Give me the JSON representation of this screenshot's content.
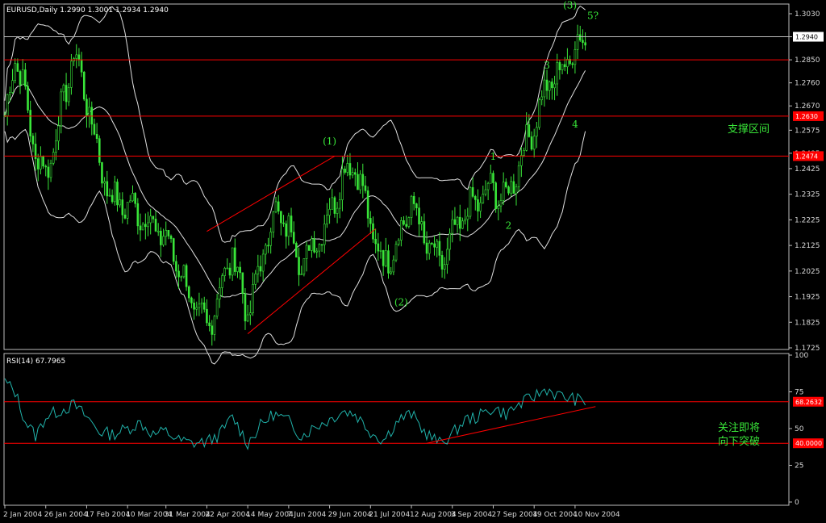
{
  "chart_data": [
    {
      "type": "candlestick",
      "title": "EURUSD,Daily  1.2990 1.3001 1.2934 1.2940",
      "ylim": [
        1.1725,
        1.304
      ],
      "y_ticks": [
        "1.3030",
        "1.2940",
        "1.2850",
        "1.2760",
        "1.2670",
        "1.2575",
        "1.2485",
        "1.2425",
        "1.2325",
        "1.2225",
        "1.2125",
        "1.2025",
        "1.1925",
        "1.1825",
        "1.1725"
      ],
      "x_ticks": [
        "2 Jan 2004",
        "26 Jan 2004",
        "17 Feb 2004",
        "10 Mar 2004",
        "31 Mar 2004",
        "22 Apr 2004",
        "14 May 2004",
        "7 Jun 2004",
        "29 Jun 2004",
        "21 Jul 2004",
        "12 Aug 2004",
        "3 Sep 2004",
        "27 Sep 2004",
        "19 Oct 2004",
        "10 Nov 2004"
      ],
      "current_price": "1.2940",
      "price_path": [
        [
          "2 Jan 2004",
          1.26
        ],
        [
          "8 Jan 2004",
          1.288
        ],
        [
          "14 Jan 2004",
          1.27
        ],
        [
          "20 Jan 2004",
          1.248
        ],
        [
          "26 Jan 2004",
          1.24
        ],
        [
          "2 Feb 2004",
          1.26
        ],
        [
          "10 Feb 2004",
          1.288
        ],
        [
          "17 Feb 2004",
          1.27
        ],
        [
          "24 Feb 2004",
          1.245
        ],
        [
          "2 Mar 2004",
          1.23
        ],
        [
          "10 Mar 2004",
          1.228
        ],
        [
          "17 Mar 2004",
          1.225
        ],
        [
          "24 Mar 2004",
          1.22
        ],
        [
          "31 Mar 2004",
          1.215
        ],
        [
          "7 Apr 2004",
          1.205
        ],
        [
          "14 Apr 2004",
          1.19
        ],
        [
          "22 Apr 2004",
          1.18
        ],
        [
          "29 Apr 2004",
          1.195
        ],
        [
          "6 May 2004",
          1.21
        ],
        [
          "14 May 2004",
          1.185
        ],
        [
          "21 May 2004",
          1.205
        ],
        [
          "28 May 2004",
          1.225
        ],
        [
          "7 Jun 2004",
          1.22
        ],
        [
          "14 Jun 2004",
          1.205
        ],
        [
          "22 Jun 2004",
          1.215
        ],
        [
          "29 Jun 2004",
          1.225
        ],
        [
          "6 Jul 2004",
          1.24
        ],
        [
          "13 Jul 2004",
          1.245
        ],
        [
          "21 Jul 2004",
          1.22
        ],
        [
          "28 Jul 2004",
          1.205
        ],
        [
          "5 Aug 2004",
          1.215
        ],
        [
          "12 Aug 2004",
          1.23
        ],
        [
          "19 Aug 2004",
          1.215
        ],
        [
          "27 Aug 2004",
          1.205
        ],
        [
          "3 Sep 2004",
          1.215
        ],
        [
          "10 Sep 2004",
          1.225
        ],
        [
          "17 Sep 2004",
          1.23
        ],
        [
          "27 Sep 2004",
          1.235
        ],
        [
          "4 Oct 2004",
          1.23
        ],
        [
          "11 Oct 2004",
          1.245
        ],
        [
          "19 Oct 2004",
          1.26
        ],
        [
          "26 Oct 2004",
          1.275
        ],
        [
          "2 Nov 2004",
          1.28
        ],
        [
          "10 Nov 2004",
          1.29
        ],
        [
          "16 Nov 2004",
          1.294
        ]
      ],
      "horizontal_lines": [
        {
          "price": 1.294,
          "label": "1.2940"
        },
        {
          "price": 1.285,
          "label": ""
        },
        {
          "price": 1.263,
          "label": "1.2630"
        },
        {
          "price": 1.2474,
          "label": "1.2474"
        }
      ],
      "channel": [
        {
          "from": [
            "22 Apr 2004",
            1.218
          ],
          "to": [
            "1 Jul 2004",
            1.2474
          ]
        },
        {
          "from": [
            "14 May 2004",
            1.178
          ],
          "to": [
            "23 Jul 2004",
            1.219
          ]
        }
      ],
      "wave_labels": [
        {
          "text": "(1)",
          "at": [
            "29 Jun 2004",
            1.252
          ]
        },
        {
          "text": "(2)",
          "at": [
            "6 Aug 2004",
            1.189
          ]
        },
        {
          "text": "(3)",
          "at": [
            "8 Nov 2004",
            1.305
          ]
        },
        {
          "text": "5?",
          "at": [
            "19 Nov 2004",
            1.301
          ]
        },
        {
          "text": "1",
          "at": [
            "27 Sep 2004",
            1.246
          ]
        },
        {
          "text": "2",
          "at": [
            "5 Oct 2004",
            1.219
          ]
        },
        {
          "text": "3",
          "at": [
            "26 Oct 2004",
            1.2815
          ]
        },
        {
          "text": "4",
          "at": [
            "10 Nov 2004",
            1.2585
          ]
        }
      ],
      "annotation": "支撑区间"
    },
    {
      "type": "line",
      "title": "RSI(14) 67.7965",
      "ylim": [
        0,
        100
      ],
      "y_ticks": [
        "100",
        "75",
        "50",
        "25",
        "0"
      ],
      "levels": [
        {
          "value": 68.2632,
          "label": "68.2632"
        },
        {
          "value": 40.0,
          "label": "40.0000"
        }
      ],
      "rsi_path": [
        [
          "2 Jan 2004",
          82
        ],
        [
          "8 Jan 2004",
          75
        ],
        [
          "14 Jan 2004",
          55
        ],
        [
          "20 Jan 2004",
          45
        ],
        [
          "26 Jan 2004",
          58
        ],
        [
          "2 Feb 2004",
          62
        ],
        [
          "10 Feb 2004",
          66
        ],
        [
          "17 Feb 2004",
          58
        ],
        [
          "24 Feb 2004",
          48
        ],
        [
          "2 Mar 2004",
          46
        ],
        [
          "10 Mar 2004",
          50
        ],
        [
          "17 Mar 2004",
          54
        ],
        [
          "24 Mar 2004",
          46
        ],
        [
          "31 Mar 2004",
          48
        ],
        [
          "7 Apr 2004",
          42
        ],
        [
          "14 Apr 2004",
          40
        ],
        [
          "22 Apr 2004",
          41
        ],
        [
          "29 Apr 2004",
          46
        ],
        [
          "6 May 2004",
          58
        ],
        [
          "14 May 2004",
          40
        ],
        [
          "21 May 2004",
          52
        ],
        [
          "28 May 2004",
          60
        ],
        [
          "7 Jun 2004",
          55
        ],
        [
          "14 Jun 2004",
          45
        ],
        [
          "22 Jun 2004",
          52
        ],
        [
          "29 Jun 2004",
          56
        ],
        [
          "6 Jul 2004",
          62
        ],
        [
          "13 Jul 2004",
          60
        ],
        [
          "21 Jul 2004",
          48
        ],
        [
          "28 Jul 2004",
          42
        ],
        [
          "5 Aug 2004",
          56
        ],
        [
          "12 Aug 2004",
          60
        ],
        [
          "19 Aug 2004",
          48
        ],
        [
          "27 Aug 2004",
          40
        ],
        [
          "3 Sep 2004",
          46
        ],
        [
          "10 Sep 2004",
          56
        ],
        [
          "17 Sep 2004",
          58
        ],
        [
          "27 Sep 2004",
          64
        ],
        [
          "4 Oct 2004",
          60
        ],
        [
          "11 Oct 2004",
          66
        ],
        [
          "19 Oct 2004",
          72
        ],
        [
          "26 Oct 2004",
          77
        ],
        [
          "2 Nov 2004",
          72
        ],
        [
          "10 Nov 2004",
          70
        ],
        [
          "16 Nov 2004",
          68
        ]
      ],
      "trendline": {
        "from": [
          "20 Aug 2004",
          40
        ],
        "to": [
          "20 Nov 2004",
          65
        ]
      },
      "annotation_lines": [
        "关注即将",
        "向下突破"
      ]
    }
  ]
}
